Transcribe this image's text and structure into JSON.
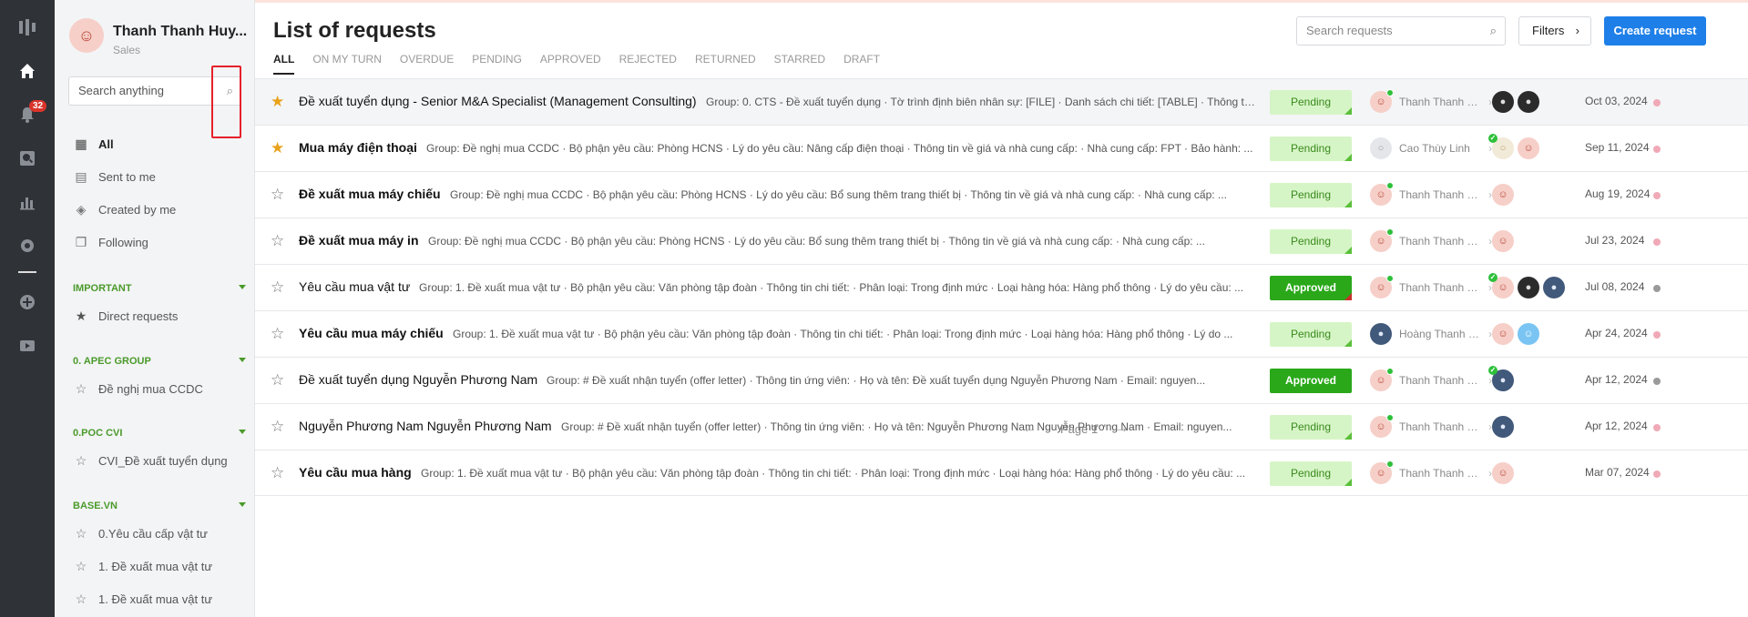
{
  "rail": {
    "badge_count": "32"
  },
  "sidebar": {
    "user_name": "Thanh Thanh Huy...",
    "user_role": "Sales",
    "search_placeholder": "Search anything",
    "nav": [
      {
        "label": "All",
        "icon": "grid-icon"
      },
      {
        "label": "Sent to me",
        "icon": "document-icon"
      },
      {
        "label": "Created by me",
        "icon": "layers-icon"
      },
      {
        "label": "Following",
        "icon": "folder-link-icon"
      }
    ],
    "sections": [
      {
        "title": "IMPORTANT",
        "items": [
          "Direct requests"
        ]
      },
      {
        "title": "0. APEC GROUP",
        "items": [
          "Đề nghị mua CCDC"
        ]
      },
      {
        "title": "0.POC CVI",
        "items": [
          "CVI_Đề xuất tuyển dụng"
        ]
      },
      {
        "title": "BASE.VN",
        "items": [
          "0.Yêu cầu cấp vật tư",
          "1. Đề xuất mua vật tư",
          "1. Đề xuất mua vật tư"
        ]
      }
    ]
  },
  "main": {
    "title": "List of requests",
    "tabs": [
      "ALL",
      "ON MY TURN",
      "OVERDUE",
      "PENDING",
      "APPROVED",
      "REJECTED",
      "RETURNED",
      "STARRED",
      "DRAFT"
    ],
    "search_placeholder": "Search requests",
    "filters_label": "Filters",
    "create_label": "Create request",
    "rows": [
      {
        "starred": true,
        "title": "Đề xuất tuyển dụng - Senior M&A Specialist (Management Consulting)",
        "bold": false,
        "desc": "Group: 0. CTS - Đề xuất tuyển dụng · Tờ trình định biên nhân sự: [FILE] · Danh sách chi tiết: [TABLE] · Thông tin ...",
        "status": "Pending",
        "owner": "Thanh Thanh Hu...",
        "date": "Oct 03, 2024",
        "flag": "pink"
      },
      {
        "starred": true,
        "title": "Mua máy điện thoại",
        "bold": true,
        "desc": "Group: Đề nghị mua CCDC · Bộ phận yêu cầu: Phòng HCNS · Lý do yêu cầu: Nâng cấp điện thoại · Thông tin về giá và nhà cung cấp: · Nhà cung cấp: FPT · Bảo hành: ...",
        "status": "Pending",
        "owner": "Cao Thùy Linh",
        "date": "Sep 11, 2024",
        "flag": "pink"
      },
      {
        "starred": false,
        "title": "Đề xuất mua máy chiếu",
        "bold": true,
        "desc": "Group: Đề nghị mua CCDC · Bộ phận yêu cầu: Phòng HCNS · Lý do yêu cầu: Bổ sung thêm trang thiết bị · Thông tin về giá và nhà cung cấp: · Nhà cung cấp: ...",
        "status": "Pending",
        "owner": "Thanh Thanh Hu...",
        "date": "Aug 19, 2024",
        "flag": "pink"
      },
      {
        "starred": false,
        "title": "Đề xuất mua máy in",
        "bold": true,
        "desc": "Group: Đề nghị mua CCDC · Bộ phận yêu cầu: Phòng HCNS · Lý do yêu cầu: Bổ sung thêm trang thiết bị · Thông tin về giá và nhà cung cấp: · Nhà cung cấp: ...",
        "status": "Pending",
        "owner": "Thanh Thanh Hu...",
        "date": "Jul 23, 2024",
        "flag": "pink"
      },
      {
        "starred": false,
        "title": "Yêu cầu mua vật tư",
        "bold": false,
        "desc": "Group: 1. Đề xuất mua vật tư · Bộ phận yêu cầu: Văn phòng tập đoàn · Thông tin chi tiết: · Phân loại: Trong định mức · Loại hàng hóa: Hàng phổ thông · Lý do yêu cầu: ...",
        "status": "Approved",
        "owner": "Thanh Thanh Hu...",
        "date": "Jul 08, 2024",
        "flag": "grey"
      },
      {
        "starred": false,
        "title": "Yêu cầu mua máy chiếu",
        "bold": true,
        "desc": "Group: 1. Đề xuất mua vật tư · Bộ phận yêu cầu: Văn phòng tập đoàn · Thông tin chi tiết: · Phân loại: Trong định mức · Loại hàng hóa: Hàng phổ thông · Lý do ...",
        "status": "Pending",
        "owner": "Hoàng Thanh N...",
        "date": "Apr 24, 2024",
        "flag": "pink"
      },
      {
        "starred": false,
        "title": "Đề xuất tuyển dụng Nguyễn Phương Nam",
        "bold": false,
        "desc": "Group: # Đề xuất nhận tuyển (offer letter) · Thông tin ứng viên: · Họ và tên: Đề xuất tuyển dụng Nguyễn Phương Nam · Email: nguyen...",
        "status": "Approved",
        "owner": "Thanh Thanh Hu...",
        "date": "Apr 12, 2024",
        "flag": "grey"
      },
      {
        "starred": false,
        "title": "Nguyễn Phương Nam Nguyễn Phương Nam",
        "bold": false,
        "desc": "Group: # Đề xuất nhận tuyển (offer letter) · Thông tin ứng viên: · Họ và tên: Nguyễn Phương Nam Nguyễn Phương Nam · Email: nguyen...",
        "status": "Pending",
        "owner": "Thanh Thanh Hu...",
        "date": "Apr 12, 2024",
        "flag": "pink"
      },
      {
        "starred": false,
        "title": "Yêu cầu mua hàng",
        "bold": true,
        "desc": "Group: 1. Đề xuất mua vật tư · Bộ phận yêu cầu: Văn phòng tập đoàn · Thông tin chi tiết: · Phân loại: Trong định mức · Loại hàng hóa: Hàng phổ thông · Lý do yêu cầu: ...",
        "status": "Pending",
        "owner": "Thanh Thanh Hu...",
        "date": "Mar 07, 2024",
        "flag": "pink"
      }
    ],
    "pagination": {
      "label": "Page 1"
    }
  }
}
